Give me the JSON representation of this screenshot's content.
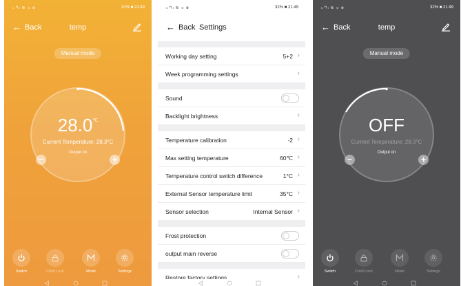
{
  "screens": {
    "main_on": {
      "status_left": "ₗₗ ᴴₗₗ ≋ ☼ ɵ",
      "status_right": "32% ■ 21:49",
      "back_label": "Back",
      "title": "temp",
      "mode_label": "Manual mode",
      "dial": {
        "value": "28.0",
        "unit": "℃",
        "current_temp": "Current Temperature: 28.3°C",
        "output": "Output on",
        "minus": "−",
        "plus": "+"
      },
      "tabs": [
        "Switch",
        "Child Lock",
        "Mode",
        "Settings"
      ],
      "colors": {
        "accent": "#f0a23a"
      }
    },
    "settings": {
      "status_left": "ₗₗ ᴴₗₗ ≋ ☼ ɵ",
      "status_right": "32% ■ 21:49",
      "back_label": "Back",
      "title": "Settings",
      "groups": [
        [
          {
            "label": "Working day setting",
            "value": "5+2",
            "kind": "chevron"
          },
          {
            "label": "Week programming settings",
            "value": "",
            "kind": "chevron"
          }
        ],
        [
          {
            "label": "Sound",
            "value": "",
            "kind": "toggle"
          },
          {
            "label": "Backlight brightness",
            "value": "",
            "kind": "chevron"
          }
        ],
        [
          {
            "label": "Temperature calibration",
            "value": "-2",
            "kind": "chevron"
          },
          {
            "label": "Max setting temperature",
            "value": "60℃",
            "kind": "chevron"
          },
          {
            "label": "Temperature control switch difference",
            "value": "1°C",
            "kind": "chevron"
          },
          {
            "label": "External Sensor temperature limit",
            "value": "35°C",
            "kind": "chevron"
          },
          {
            "label": "Sensor selection",
            "value": "Internal Sensor",
            "kind": "chevron"
          }
        ],
        [
          {
            "label": "Frost protection",
            "value": "",
            "kind": "toggle"
          },
          {
            "label": "output main reverse",
            "value": "",
            "kind": "toggle"
          }
        ],
        [
          {
            "label": "Restore factory settings",
            "value": "",
            "kind": "chevron"
          }
        ]
      ]
    },
    "main_off": {
      "status_left": "ₗₗ ᴴₗₗ ≋ ☼ ɵ",
      "status_right": "32% ■ 21:49",
      "back_label": "Back",
      "title": "temp",
      "mode_label": "Manual mode",
      "dial": {
        "value": "OFF",
        "current_temp": "Current Temperature: 28.3°C",
        "output": "Output on",
        "minus": "−",
        "plus": "+"
      },
      "tabs": [
        "Switch",
        "Child Lock",
        "Mode",
        "Settings"
      ],
      "colors": {
        "background": "#4f4f51"
      }
    }
  }
}
